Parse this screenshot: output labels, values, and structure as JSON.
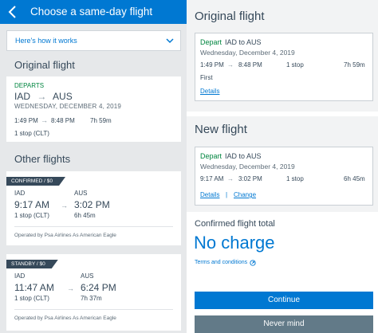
{
  "header": {
    "title": "Choose a same-day flight"
  },
  "how_it_works": {
    "label": "Here's how it works"
  },
  "left_original": {
    "section_title": "Original flight",
    "departs_label": "DEPARTS",
    "from": "IAD",
    "to": "AUS",
    "date": "WEDNESDAY, DECEMBER 4, 2019",
    "depart_time": "1:49 PM",
    "arrive_time": "8:48 PM",
    "duration": "7h 59m",
    "stops": "1 stop (CLT)"
  },
  "other_flights": {
    "section_title": "Other flights",
    "flights": [
      {
        "tag": "CONFIRMED / $0",
        "from": "IAD",
        "to": "AUS",
        "depart_time": "9:17 AM",
        "arrive_time": "3:02 PM",
        "stops": "1 stop (CLT)",
        "duration": "6h 45m",
        "operator": "Operated by Psa Airlines As American Eagle"
      },
      {
        "tag": "STANDBY / $0",
        "from": "IAD",
        "to": "AUS",
        "depart_time": "11:47 AM",
        "arrive_time": "6:24 PM",
        "stops": "1 stop (CLT)",
        "duration": "7h 37m",
        "operator": "Operated by Psa Airlines As American Eagle"
      }
    ]
  },
  "right_original": {
    "section_title": "Original flight",
    "depart_label": "Depart",
    "route": "IAD to AUS",
    "date": "Wednesday, December 4, 2019",
    "depart_time": "1:49 PM",
    "arrive_time": "8:48 PM",
    "stops": "1 stop",
    "duration": "7h 59m",
    "cabin": "First",
    "details_link": "Details"
  },
  "right_new": {
    "section_title": "New flight",
    "depart_label": "Depart",
    "route": "IAD to AUS",
    "date": "Wednesday, December 4, 2019",
    "depart_time": "9:17 AM",
    "arrive_time": "3:02 PM",
    "stops": "1 stop",
    "duration": "6h 45m",
    "details_link": "Details",
    "separator": "|",
    "change_link": "Change"
  },
  "total": {
    "label": "Confirmed flight total",
    "value": "No charge",
    "terms_link": "Terms and conditions"
  },
  "buttons": {
    "continue": "Continue",
    "never_mind": "Never mind"
  },
  "colors": {
    "brand_blue": "#0078d2",
    "depart_green": "#00853f",
    "text_dark": "#36495a",
    "secondary_button": "#627a88"
  },
  "icons": {
    "back": "chevron-left-icon",
    "expand": "chevron-down-icon",
    "route_arrow": "arrow-right-icon",
    "external": "external-link-icon"
  }
}
